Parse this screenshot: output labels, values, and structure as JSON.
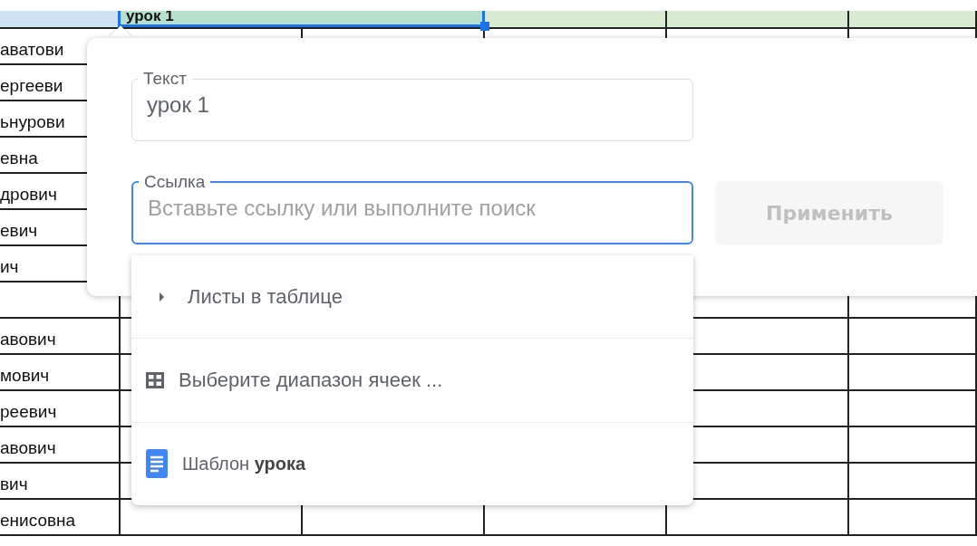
{
  "sheet": {
    "header_cells": [
      {
        "text": "",
        "kind": "name"
      },
      {
        "text": "урок 1",
        "kind": "selected"
      },
      {
        "text": "",
        "kind": "plain"
      },
      {
        "text": "",
        "kind": "plain"
      },
      {
        "text": "",
        "kind": "plain"
      }
    ],
    "name_cells": [
      "аватови",
      "ергееви",
      "ьнурови",
      "евна",
      "дрович",
      "евич",
      "ич",
      "",
      "авович",
      "мович",
      "реевич",
      "авович",
      "вич",
      "енисовна"
    ]
  },
  "link_dialog": {
    "text_field": {
      "label": "Текст",
      "value": "урок 1"
    },
    "link_field": {
      "label": "Ссылка",
      "placeholder": "Вставьте ссылку или выполните поиск",
      "focused": true
    },
    "apply_button": {
      "label": "Применить",
      "disabled": true
    },
    "suggestions": [
      {
        "kind": "expander",
        "label": "Листы в таблице"
      },
      {
        "kind": "range",
        "label": "Выберите диапазон ячеек ..."
      },
      {
        "kind": "document",
        "label": "Шаблон **урока**"
      }
    ]
  }
}
